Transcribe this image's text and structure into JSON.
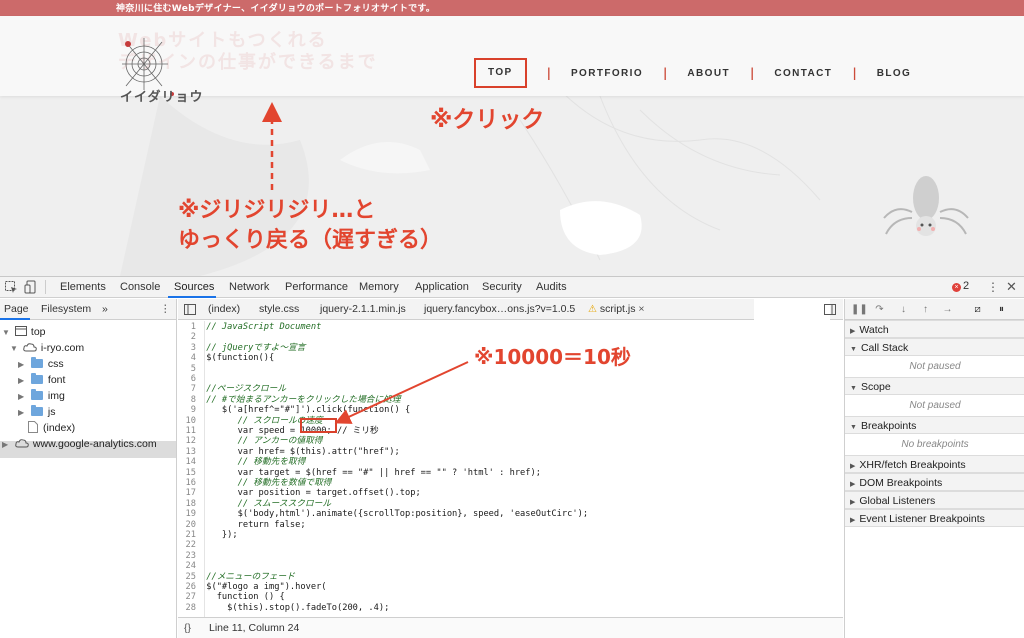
{
  "website": {
    "tagline": "神奈川に住むWebデザイナー、イイダリョウのポートフォリオサイトです。",
    "hero_text_1": "Webサイトもつくれる",
    "hero_text_2": "デザインの仕事ができるまで",
    "logo_text": "イイダリョウ",
    "nav": [
      {
        "label": "TOP"
      },
      {
        "label": "PORTFORIO"
      },
      {
        "label": "ABOUT"
      },
      {
        "label": "CONTACT"
      },
      {
        "label": "BLOG"
      }
    ],
    "nav_separator": "|",
    "annotation_click": "※クリック",
    "annotation_slow_1": "※ジリジリジリ…と",
    "annotation_slow_2": "ゆっくり戻る（遅すぎる）",
    "accent_color": "#e2452f"
  },
  "devtools": {
    "tabs": [
      "Elements",
      "Console",
      "Sources",
      "Network",
      "Performance",
      "Memory",
      "Application",
      "Security",
      "Audits"
    ],
    "active_tab": "Sources",
    "error_count": "2",
    "navigator": {
      "tabs": [
        "Page",
        "Filesystem",
        "»"
      ],
      "tree": [
        {
          "label": "top"
        },
        {
          "label": "i-ryo.com"
        },
        {
          "label": "css"
        },
        {
          "label": "font"
        },
        {
          "label": "img"
        },
        {
          "label": "js"
        },
        {
          "label": "(index)"
        },
        {
          "label": "www.google-analytics.com"
        }
      ]
    },
    "file_tabs": [
      "(index)",
      "style.css",
      "jquery-2.1.1.min.js",
      "jquery.fancybox…ons.js?v=1.0.5",
      "script.js"
    ],
    "status_bar": {
      "braces": "{}",
      "position": "Line 11, Column 24"
    },
    "code_lines": [
      {
        "n": "1",
        "text": "// JavaScript Document"
      },
      {
        "n": "2",
        "text": ""
      },
      {
        "n": "3",
        "text": "// jQueryですよ～宣言"
      },
      {
        "n": "4",
        "text": "$(function(){"
      },
      {
        "n": "5",
        "text": ""
      },
      {
        "n": "6",
        "text": ""
      },
      {
        "n": "7",
        "text": "//ページスクロール"
      },
      {
        "n": "8",
        "text": "// #で始まるアンカーをクリックした場合に処理"
      },
      {
        "n": "9",
        "text": "   $('a[href^=\"#\"]').click(function() {"
      },
      {
        "n": "10",
        "text": "      // スクロールの速度"
      },
      {
        "n": "11",
        "text": "      var speed = 10000; // ミリ秒"
      },
      {
        "n": "12",
        "text": "      // アンカーの値取得"
      },
      {
        "n": "13",
        "text": "      var href= $(this).attr(\"href\");"
      },
      {
        "n": "14",
        "text": "      // 移動先を取得"
      },
      {
        "n": "15",
        "text": "      var target = $(href == \"#\" || href == \"\" ? 'html' : href);"
      },
      {
        "n": "16",
        "text": "      // 移動先を数値で取得"
      },
      {
        "n": "17",
        "text": "      var position = target.offset().top;"
      },
      {
        "n": "18",
        "text": "      // スムーススクロール"
      },
      {
        "n": "19",
        "text": "      $('body,html').animate({scrollTop:position}, speed, 'easeOutCirc');"
      },
      {
        "n": "20",
        "text": "      return false;"
      },
      {
        "n": "21",
        "text": "   });"
      },
      {
        "n": "22",
        "text": ""
      },
      {
        "n": "23",
        "text": ""
      },
      {
        "n": "24",
        "text": ""
      },
      {
        "n": "25",
        "text": "//メニューのフェード"
      },
      {
        "n": "26",
        "text": "$(\"#logo a img\").hover("
      },
      {
        "n": "27",
        "text": "  function () {"
      },
      {
        "n": "28",
        "text": "    $(this).stop().fadeTo(200, .4);"
      }
    ],
    "right_pane": {
      "sections": [
        {
          "title": "Watch",
          "body": ""
        },
        {
          "title": "Call Stack",
          "body": "Not paused"
        },
        {
          "title": "Scope",
          "body": "Not paused"
        },
        {
          "title": "Breakpoints",
          "body": "No breakpoints"
        },
        {
          "title": "XHR/fetch Breakpoints",
          "body": ""
        },
        {
          "title": "DOM Breakpoints",
          "body": ""
        },
        {
          "title": "Global Listeners",
          "body": ""
        },
        {
          "title": "Event Listener Breakpoints",
          "body": ""
        }
      ]
    },
    "annotation_speed": "※10000＝10秒"
  }
}
